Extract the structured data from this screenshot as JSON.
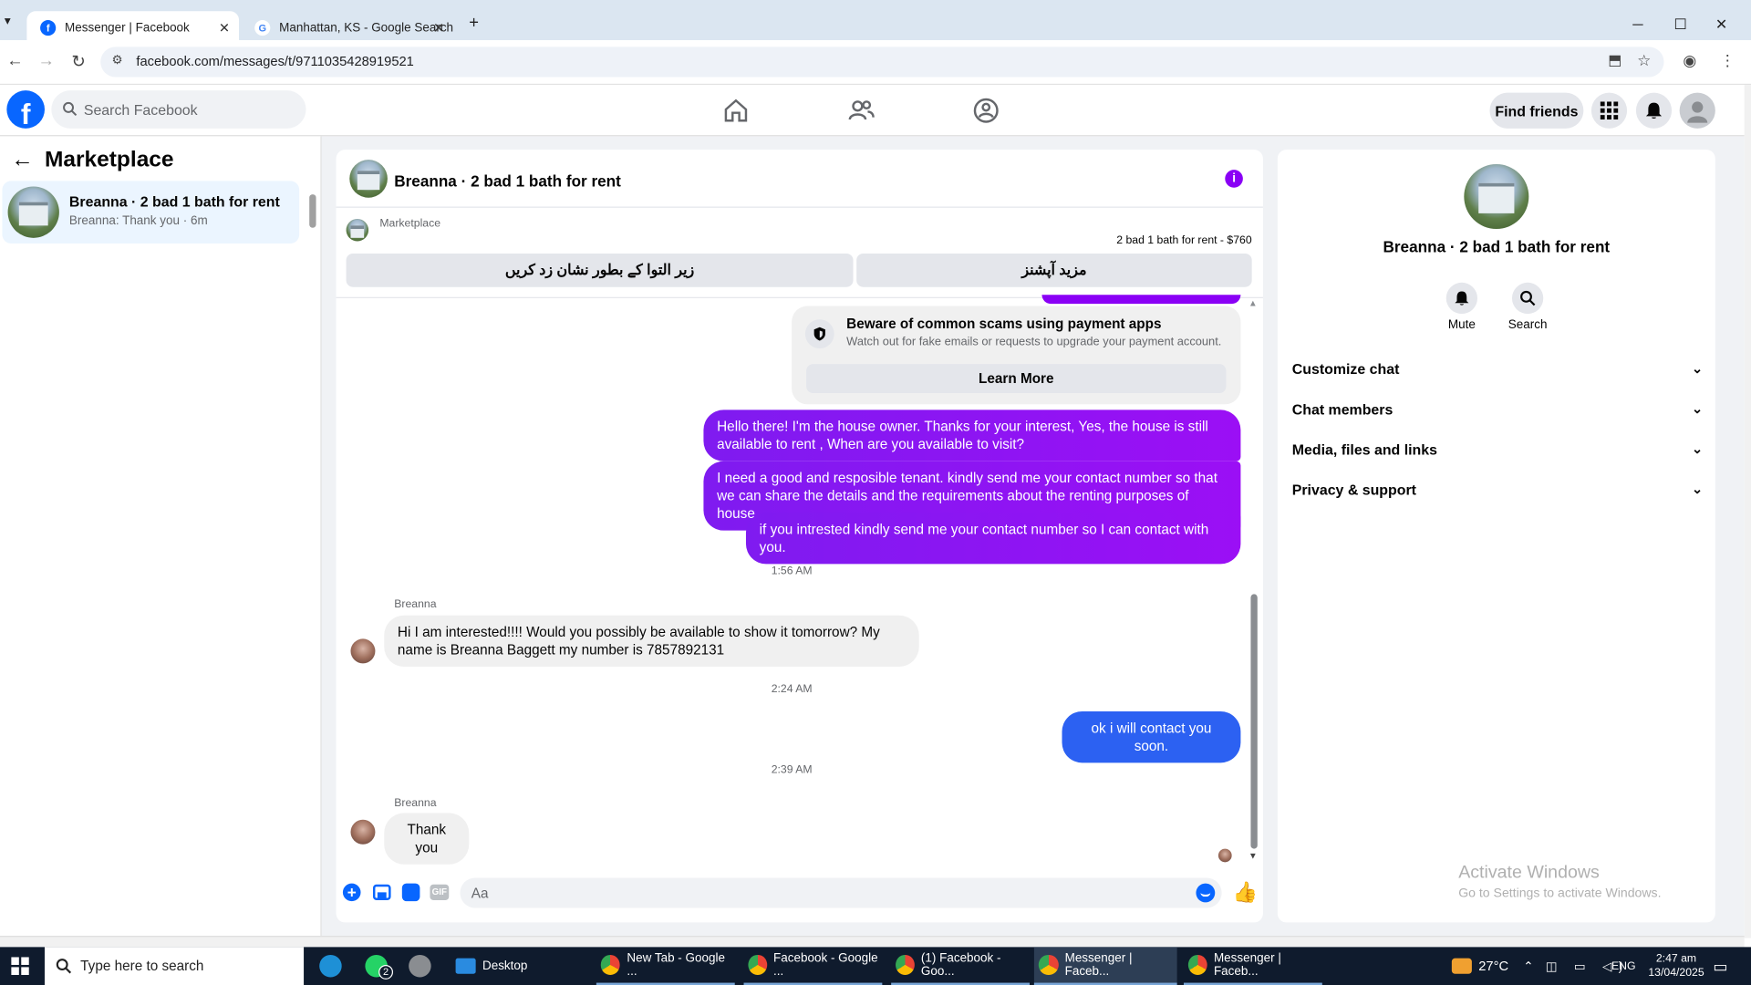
{
  "browser": {
    "tabs": [
      {
        "title": "Messenger | Facebook",
        "active": true
      },
      {
        "title": "Manhattan, KS - Google Search",
        "active": false
      }
    ],
    "url": "facebook.com/messages/t/9711035428919521"
  },
  "fb_header": {
    "search_placeholder": "Search Facebook",
    "find_friends": "Find friends"
  },
  "sidebar": {
    "title": "Marketplace",
    "conversation": {
      "name": "Breanna · 2 bad 1 bath for rent",
      "preview": "Breanna: Thank you · 6m"
    }
  },
  "chat": {
    "header_title": "Breanna · 2 bad 1 bath for rent",
    "marketplace_label": "Marketplace",
    "listing": "2 bad 1 bath for rent - $760",
    "btn_mark_pending": "زیر التوا کے بطور نشان زد کریں",
    "btn_more_options": "مزید آپشنز",
    "scam_title": "Beware of common scams using payment apps",
    "scam_text": "Watch out for fake emails or requests to upgrade your payment account.",
    "learn_more": "Learn More",
    "msg1": "Hello there! I'm the house owner. Thanks for your interest, Yes, the house is still available to rent , When are you available to visit?",
    "msg2": "I need a good and resposible tenant.  kindly send me your contact number so that we can share the details and the requirements about the renting purposes of house.",
    "msg3": "if you intrested kindly send me your contact number so I can contact with you.",
    "ts1": "1:56 AM",
    "sender1": "Breanna",
    "msg4": "Hi I am interested!!!! Would you possibly be available to show it tomorrow? My name is Breanna Baggett my number is 7857892131",
    "ts2": "2:24 AM",
    "msg5": "ok i will contact you soon.",
    "ts3": "2:39 AM",
    "sender2": "Breanna",
    "msg6": "Thank you",
    "composer_placeholder": "Aa"
  },
  "details": {
    "title": "Breanna · 2 bad 1 bath for rent",
    "mute": "Mute",
    "search": "Search",
    "sections": [
      "Customize chat",
      "Chat members",
      "Media, files and links",
      "Privacy & support"
    ],
    "watermark_title": "Activate Windows",
    "watermark_text": "Go to Settings to activate Windows."
  },
  "taskbar": {
    "search_placeholder": "Type here to search",
    "whatsapp_badge": "2",
    "items": [
      "Desktop",
      "New Tab - Google ...",
      "Facebook - Google ...",
      "(1) Facebook - Goo...",
      "Messenger | Faceb...",
      "Messenger | Faceb..."
    ],
    "temperature": "27°C",
    "language": "ENG",
    "time": "2:47 am",
    "date": "13/04/2025"
  },
  "colors": {
    "fb_blue": "#0866ff",
    "bubble_purple": "#8a00f5",
    "bubble_blue": "#2c61f2",
    "taskbar": "#0f1b2d"
  }
}
